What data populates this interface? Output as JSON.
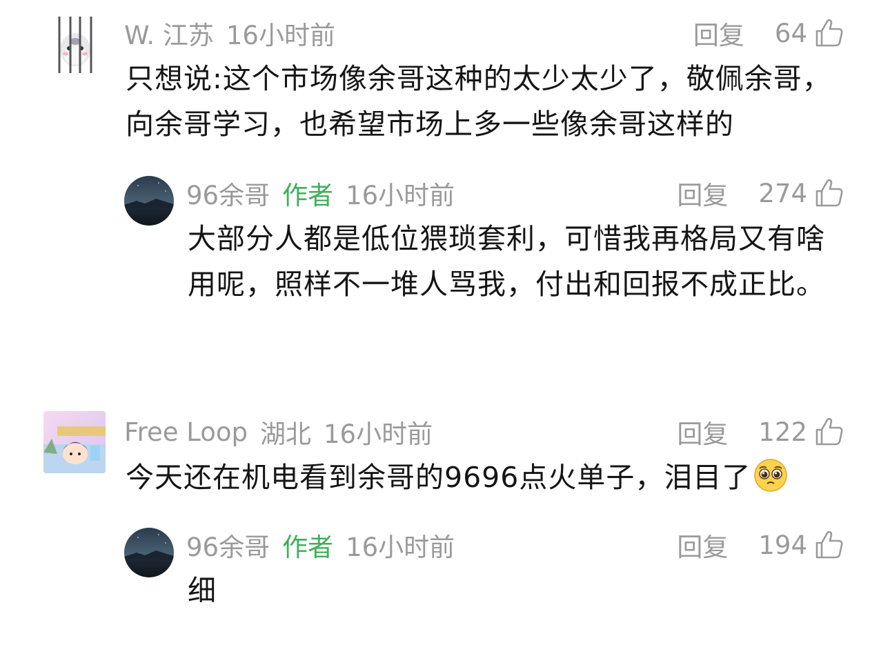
{
  "comments": [
    {
      "user": "W. 江苏",
      "time": "16小时前",
      "reply_label": "回复",
      "likes": "64",
      "text": "只想说:这个市场像余哥这种的太少太少了，敬佩余哥，向余哥学习，也希望市场上多一些像余哥这样的"
    },
    {
      "user": "96余哥",
      "author_tag": "作者",
      "time": "16小时前",
      "reply_label": "回复",
      "likes": "274",
      "text": "大部分人都是低位猥琐套利，可惜我再格局又有啥用呢，照样不一堆人骂我，付出和回报不成正比。"
    },
    {
      "user": "Free Loop",
      "location": "湖北",
      "time": "16小时前",
      "reply_label": "回复",
      "likes": "122",
      "text": "今天还在机电看到余哥的9696点火单子，泪目了",
      "emoji": "pleading-face-emoji"
    },
    {
      "user": "96余哥",
      "author_tag": "作者",
      "time": "16小时前",
      "reply_label": "回复",
      "likes": "194",
      "text": "细"
    }
  ],
  "colors": {
    "meta_gray": "#9a9a9a",
    "author_green": "#3fae5a",
    "body_text": "#151515"
  }
}
